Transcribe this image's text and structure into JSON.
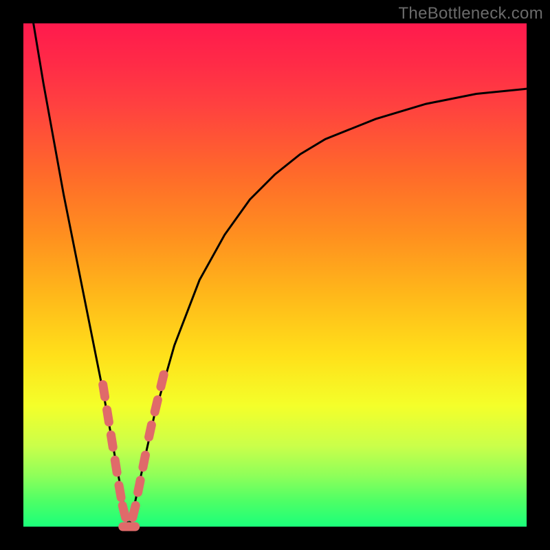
{
  "watermark": "TheBottleneck.com",
  "chart_data": {
    "type": "line",
    "title": "",
    "xlabel": "",
    "ylabel": "",
    "xlim": [
      0,
      100
    ],
    "ylim": [
      0,
      100
    ],
    "grid": false,
    "series": [
      {
        "name": "bottleneck-curve",
        "x": [
          2,
          4,
          6,
          8,
          10,
          12,
          14,
          16,
          18,
          20,
          21,
          22,
          24,
          26,
          30,
          35,
          40,
          45,
          50,
          55,
          60,
          70,
          80,
          90,
          100
        ],
        "y": [
          100,
          88,
          77,
          66,
          56,
          46,
          36,
          26,
          15,
          4,
          0,
          4,
          13,
          22,
          36,
          49,
          58,
          65,
          70,
          74,
          77,
          81,
          84,
          86,
          87
        ],
        "color": "#000000"
      }
    ],
    "markers": {
      "name": "highlight-dots",
      "color": "#e06a6a",
      "points": [
        {
          "x": 16.0,
          "y": 27
        },
        {
          "x": 16.8,
          "y": 22
        },
        {
          "x": 17.6,
          "y": 17
        },
        {
          "x": 18.4,
          "y": 12
        },
        {
          "x": 19.2,
          "y": 7
        },
        {
          "x": 20.0,
          "y": 3
        },
        {
          "x": 21.0,
          "y": 0
        },
        {
          "x": 22.0,
          "y": 3
        },
        {
          "x": 23.0,
          "y": 8
        },
        {
          "x": 24.0,
          "y": 13
        },
        {
          "x": 25.2,
          "y": 19
        },
        {
          "x": 26.4,
          "y": 24
        },
        {
          "x": 27.6,
          "y": 29
        }
      ]
    }
  }
}
